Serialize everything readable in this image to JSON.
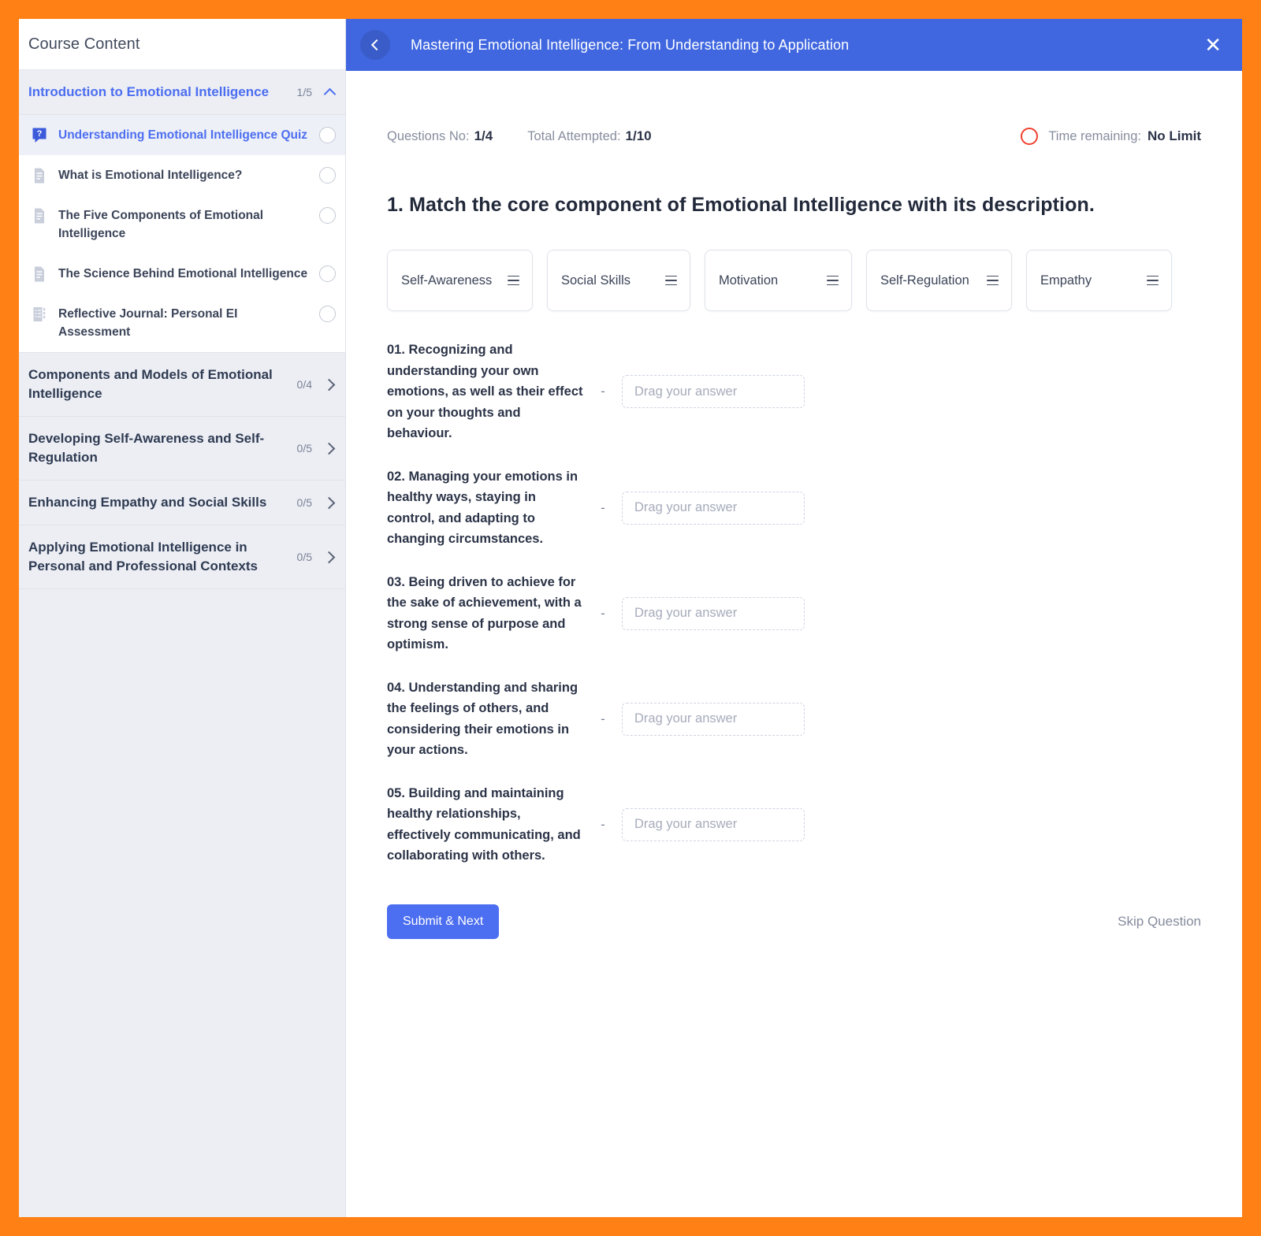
{
  "theme": {
    "page_border": "#ff8015",
    "accent_blue": "#4c6ef0",
    "topbar_blue": "#4067e0",
    "timer_red": "#f0402f",
    "sidebar_bg": "#eceef4"
  },
  "sidebar": {
    "header_title": "Course Content",
    "sections": [
      {
        "title": "Introduction to Emotional Intelligence",
        "count": "1/5",
        "expanded": true,
        "chevron_icon": "chevron-up-icon",
        "lessons": [
          {
            "label": "Understanding Emotional Intelligence Quiz",
            "icon": "quiz-bubble-icon",
            "current": true,
            "status_icon": "circle-outline-icon"
          },
          {
            "label": "What is Emotional Intelligence?",
            "icon": "document-icon",
            "current": false,
            "status_icon": "circle-outline-icon"
          },
          {
            "label": "The Five Components of Emotional Intelligence",
            "icon": "document-icon",
            "current": false,
            "status_icon": "circle-outline-icon"
          },
          {
            "label": "The Science Behind Emotional Intelligence",
            "icon": "document-icon",
            "current": false,
            "status_icon": "circle-outline-icon"
          },
          {
            "label": "Reflective Journal: Personal EI Assessment",
            "icon": "assignment-icon",
            "current": false,
            "status_icon": "circle-outline-icon"
          }
        ]
      },
      {
        "title": "Components and Models of Emotional Intelligence",
        "count": "0/4",
        "expanded": false,
        "chevron_icon": "chevron-right-icon",
        "lessons": []
      },
      {
        "title": "Developing Self-Awareness and Self-Regulation",
        "count": "0/5",
        "expanded": false,
        "chevron_icon": "chevron-right-icon",
        "lessons": []
      },
      {
        "title": "Enhancing Empathy and Social Skills",
        "count": "0/5",
        "expanded": false,
        "chevron_icon": "chevron-right-icon",
        "lessons": []
      },
      {
        "title": "Applying Emotional Intelligence in Personal and Professional Contexts",
        "count": "0/5",
        "expanded": false,
        "chevron_icon": "chevron-right-icon",
        "lessons": []
      }
    ]
  },
  "topbar": {
    "back_icon": "chevron-left-icon",
    "title": "Mastering Emotional Intelligence: From Understanding to Application",
    "close_icon": "close-icon",
    "close_glyph": "✕"
  },
  "quiz": {
    "questions_no_label": "Questions No:",
    "questions_no_value": "1/4",
    "total_attempted_label": "Total Attempted:",
    "total_attempted_value": "1/10",
    "timer_icon": "timer-circle-icon",
    "time_remaining_label": "Time remaining:",
    "time_remaining_value": "No Limit",
    "question_title": "1. Match the core component of Emotional Intelligence with its description.",
    "drag_chips": [
      {
        "label": "Self-Awareness",
        "grip_icon": "drag-handle-icon"
      },
      {
        "label": "Social Skills",
        "grip_icon": "drag-handle-icon"
      },
      {
        "label": "Motivation",
        "grip_icon": "drag-handle-icon"
      },
      {
        "label": "Self-Regulation",
        "grip_icon": "drag-handle-icon"
      },
      {
        "label": "Empathy",
        "grip_icon": "drag-handle-icon"
      }
    ],
    "separator": "-",
    "dropzone_placeholder": "Drag your answer",
    "match_items": [
      {
        "number": "01.",
        "text": "01. Recognizing and understanding your own emotions, as well as their effect on your thoughts and behaviour.",
        "answer": ""
      },
      {
        "number": "02.",
        "text": "02. Managing your emotions in healthy ways, staying in control, and adapting to changing circumstances.",
        "answer": ""
      },
      {
        "number": "03.",
        "text": "03. Being driven to achieve for the sake of achievement, with a strong sense of purpose and optimism.",
        "answer": ""
      },
      {
        "number": "04.",
        "text": "04. Understanding and sharing the feelings of others, and considering their emotions in your actions.",
        "answer": ""
      },
      {
        "number": "05.",
        "text": "05. Building and maintaining healthy relationships, effectively communicating, and collaborating with others.",
        "answer": ""
      }
    ],
    "submit_label": "Submit & Next",
    "skip_label": "Skip Question"
  }
}
